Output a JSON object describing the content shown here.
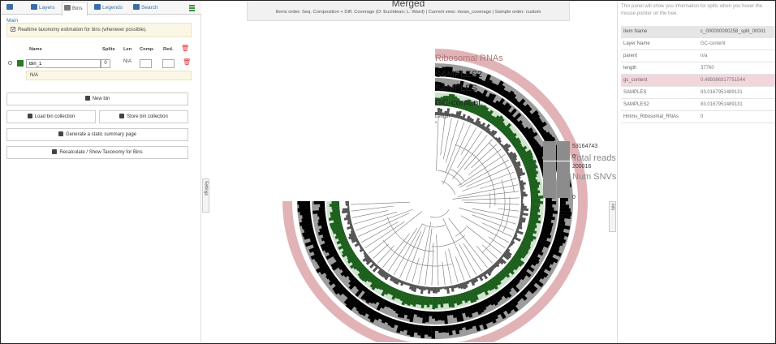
{
  "tabs": [
    {
      "label": "Main",
      "icon": "home-icon"
    },
    {
      "label": "Layers",
      "icon": "layers-icon"
    },
    {
      "label": "Bins",
      "icon": "bins-icon"
    },
    {
      "label": "Legends",
      "icon": "legends-icon"
    },
    {
      "label": "Search",
      "icon": "search-icon"
    }
  ],
  "bins_panel": {
    "realtime_label": "Realtime taxonomy estimation for bins (whenever possible).",
    "realtime_checked": true,
    "columns": {
      "name": "Name",
      "splits": "Splits",
      "len": "Len",
      "comp": "Comp.",
      "red": "Red."
    },
    "bin": {
      "name": "Bin_1",
      "splits": "0",
      "len": "N/A",
      "taxonomy": "N/A",
      "color": "#2a7a2a"
    },
    "buttons": {
      "new_bin": "New bin",
      "load": "Load bin collection",
      "store": "Store bin collection",
      "summary": "Generate a static summary page",
      "recalc": "Recalculate / Show Taxonomy for Bins"
    }
  },
  "handles": {
    "left": "Settings",
    "right": "Info"
  },
  "center": {
    "title": "Merged",
    "subtitle": "Items order: Seq. Composition + Diff. Coverage (D: Euclidean; L: Ward) | Current view: mean_coverage | Sample order: custom"
  },
  "tree": {
    "layers": [
      "Ribosomal RNAs",
      "SAMPLES2",
      "SAMPLES",
      "GC-content",
      "Length"
    ],
    "length_sub": "0",
    "colors": {
      "ribosomal": "#e1b3b7",
      "samples2": "#000000",
      "samples": "#000000",
      "gc": "#1c5e1c",
      "gc_light": "#cfe3cf",
      "grey": "#9c9c9c",
      "dark_grey": "#555555"
    }
  },
  "bars": [
    {
      "max": "53164743",
      "min": "0",
      "label": "Total reads mapped"
    },
    {
      "max": "200016",
      "min": "0",
      "label": "Num SNVs reported"
    }
  ],
  "right_panel": {
    "hint": "This panel will show you information for splits when you hover the mouse pointer on the tree.",
    "rows": [
      {
        "key": "Item Name",
        "value": "c_000000000258_split_00001"
      },
      {
        "key": "Layer Name",
        "value": "GC-content"
      },
      {
        "key": "parent",
        "value": "n/a"
      },
      {
        "key": "length",
        "value": "37760"
      },
      {
        "key": "gc_content",
        "value": "0.489386317751544"
      },
      {
        "key": "SAMPLES",
        "value": "83.0167951489131"
      },
      {
        "key": "SAMPLES2",
        "value": "83.0167951489131"
      },
      {
        "key": "Hmms_Ribosomal_RNAs",
        "value": "0"
      }
    ]
  }
}
